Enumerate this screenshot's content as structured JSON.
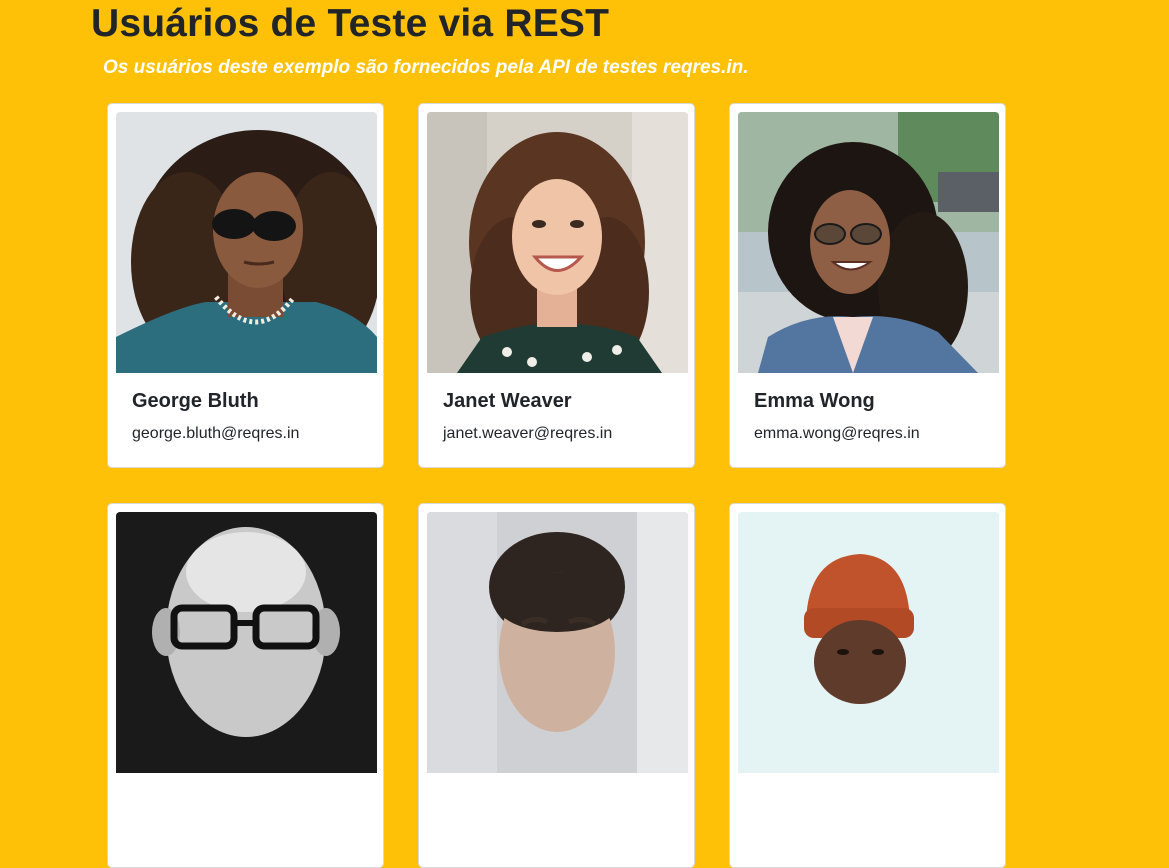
{
  "header": {
    "title": "Usuários de Teste via REST",
    "subtitle": "Os usuários deste exemplo são fornecidos pela API de testes reqres.in."
  },
  "users": [
    {
      "name": "George Bluth",
      "email": "george.bluth@reqres.in"
    },
    {
      "name": "Janet Weaver",
      "email": "janet.weaver@reqres.in"
    },
    {
      "name": "Emma Wong",
      "email": "emma.wong@reqres.in"
    },
    {
      "name": "",
      "email": ""
    },
    {
      "name": "",
      "email": ""
    },
    {
      "name": "",
      "email": ""
    }
  ],
  "colors": {
    "background": "#FFC107",
    "card": "#FFFFFF",
    "text": "#212529",
    "subtitle": "#FFFFFF"
  }
}
